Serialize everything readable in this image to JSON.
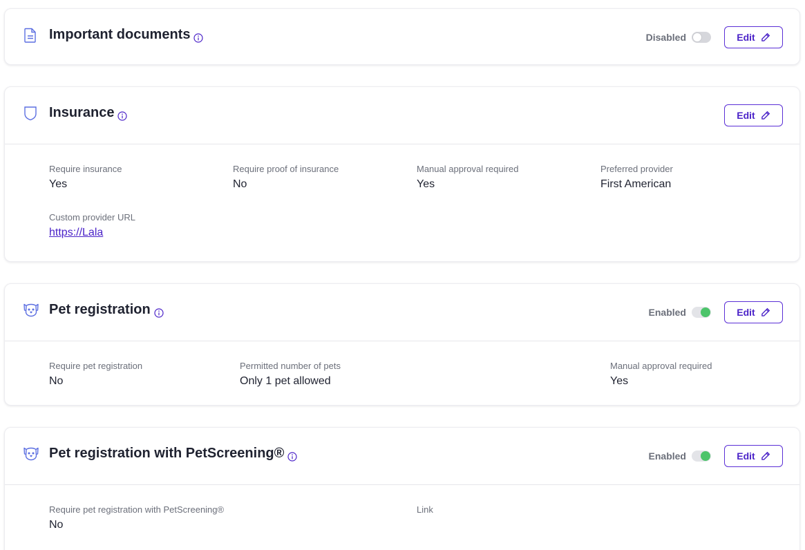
{
  "cards": {
    "documents": {
      "title": "Important documents",
      "status": "Disabled",
      "enabled": false,
      "edit_label": "Edit"
    },
    "insurance": {
      "title": "Insurance",
      "edit_label": "Edit",
      "fields": [
        {
          "label": "Require insurance",
          "value": "Yes"
        },
        {
          "label": "Require proof of insurance",
          "value": "No"
        },
        {
          "label": "Manual approval required",
          "value": "Yes"
        },
        {
          "label": "Preferred provider",
          "value": "First American"
        },
        {
          "label": "Custom provider URL",
          "value": "https://Lala"
        }
      ]
    },
    "pet_registration": {
      "title": "Pet registration",
      "status": "Enabled",
      "enabled": true,
      "edit_label": "Edit",
      "fields": [
        {
          "label": "Require pet registration",
          "value": "No"
        },
        {
          "label": "Permitted number of pets",
          "value": "Only 1 pet allowed"
        },
        {
          "label": "Manual approval required",
          "value": "Yes"
        }
      ]
    },
    "petscreening": {
      "title": "Pet registration with PetScreening®",
      "status": "Enabled",
      "enabled": true,
      "edit_label": "Edit",
      "fields": [
        {
          "label": "Require pet registration with PetScreening®",
          "value": "No"
        },
        {
          "label": "Link",
          "value": ""
        }
      ]
    }
  },
  "icons": {
    "documents": "document-icon",
    "insurance": "shield-icon",
    "pet": "dog-icon",
    "info": "info-icon",
    "edit": "pencil-icon"
  },
  "colors": {
    "accent": "#4a22c8",
    "icon_blue": "#5b6ee1",
    "toggle_on": "#4cc46a"
  }
}
